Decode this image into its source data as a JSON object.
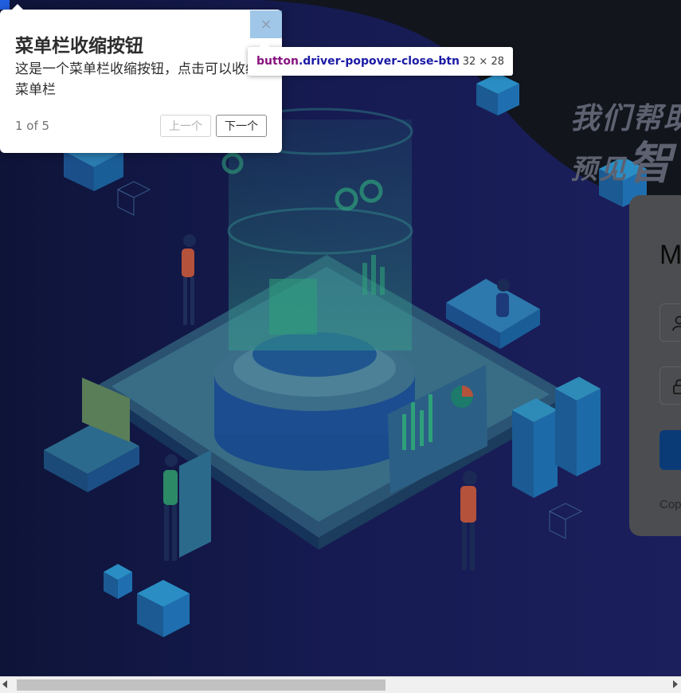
{
  "background": {
    "slogan_line1": "我们帮助",
    "slogan_line2_prefix": "预见",
    "slogan_line2_big": "智",
    "colors": {
      "dark": "#12141b",
      "navy": "#181e55",
      "cube": "#1f6fb0"
    }
  },
  "login": {
    "title": "M",
    "username_icon": "user-icon",
    "password_icon": "lock-icon",
    "copyright": "Cop"
  },
  "popover": {
    "title": "菜单栏收缩按钮",
    "description": "这是一个菜单栏收缩按钮，点击可以收缩菜单栏",
    "progress": "1 of 5",
    "prev_label": "上一个",
    "next_label": "下一个",
    "close_label": "×"
  },
  "inspect_tooltip": {
    "tag": "button",
    "class_name": ".driver-popover-close-btn",
    "size": "32 × 28"
  },
  "scrollbar": {
    "left_icon": "arrow-left-icon",
    "right_icon": "arrow-right-icon"
  }
}
